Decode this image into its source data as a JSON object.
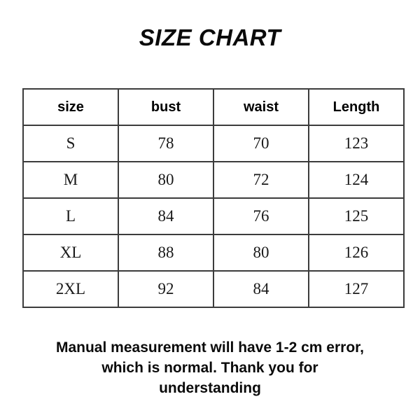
{
  "title": "SIZE CHART",
  "table": {
    "columns": [
      "size",
      "bust",
      "waist",
      "Length"
    ],
    "rows": [
      {
        "size": "S",
        "bust": "78",
        "waist": "70",
        "length": "123"
      },
      {
        "size": "M",
        "bust": "80",
        "waist": "72",
        "length": "124"
      },
      {
        "size": "L",
        "bust": "84",
        "waist": "76",
        "length": "125"
      },
      {
        "size": "XL",
        "bust": "88",
        "waist": "80",
        "length": "126"
      },
      {
        "size": "2XL",
        "bust": "92",
        "waist": "84",
        "length": "127"
      }
    ]
  },
  "footer": {
    "note": "Manual measurement will have 1-2 cm error, which is normal. Thank you for understanding"
  },
  "colors": {
    "background": "#ffffff",
    "text": "#000000",
    "border": "#3c3c3c",
    "cell_text": "#1a1a1a"
  }
}
